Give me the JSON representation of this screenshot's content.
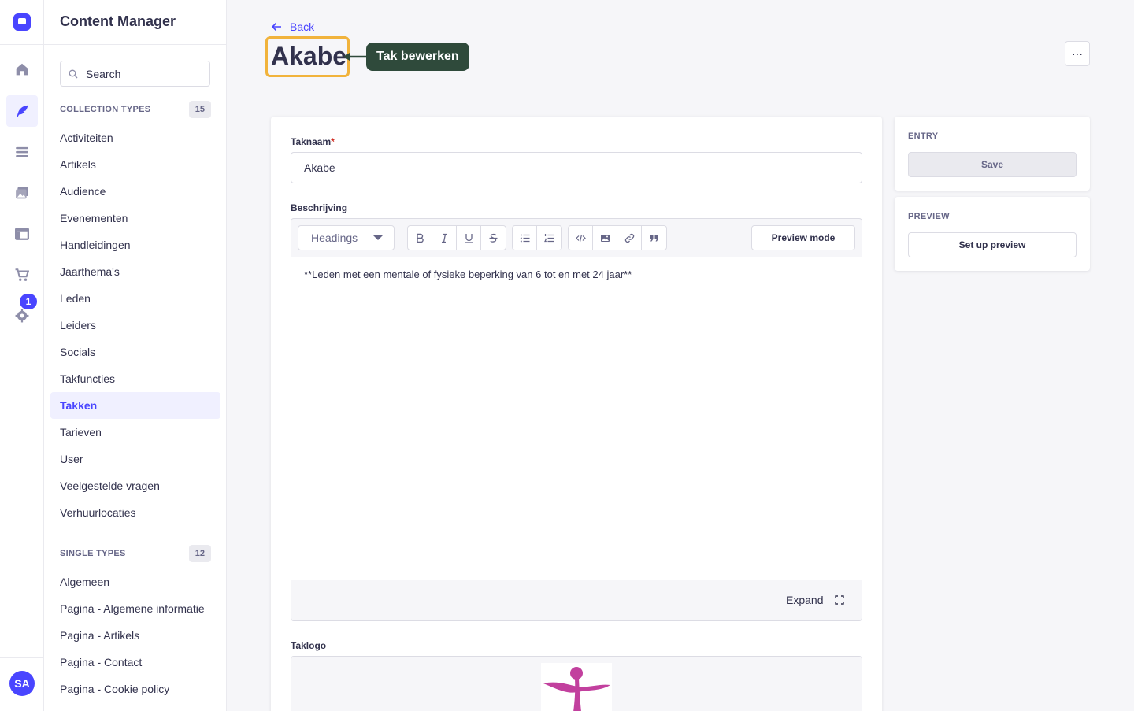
{
  "app": {
    "title": "Content Manager",
    "avatar_initials": "SA",
    "notification_count": "1"
  },
  "rail": {
    "items": [
      {
        "icon": "house-icon"
      },
      {
        "icon": "feather-icon",
        "active": true
      },
      {
        "icon": "list-icon"
      },
      {
        "icon": "images-icon"
      },
      {
        "icon": "layout-icon"
      },
      {
        "icon": "cart-icon"
      },
      {
        "icon": "gear-icon"
      }
    ]
  },
  "sidebar": {
    "search_placeholder": "Search",
    "collection": {
      "label": "COLLECTION TYPES",
      "count": "15",
      "items": [
        "Activiteiten",
        "Artikels",
        "Audience",
        "Evenementen",
        "Handleidingen",
        "Jaarthema's",
        "Leden",
        "Leiders",
        "Socials",
        "Takfuncties",
        "Takken",
        "Tarieven",
        "User",
        "Veelgestelde vragen",
        "Verhuurlocaties"
      ],
      "active": "Takken"
    },
    "single": {
      "label": "SINGLE TYPES",
      "count": "12",
      "items": [
        "Algemeen",
        "Pagina - Algemene informatie",
        "Pagina - Artikels",
        "Pagina - Contact",
        "Pagina - Cookie policy"
      ]
    }
  },
  "header": {
    "back_label": "Back",
    "title": "Akabe",
    "annotation": "Tak bewerken",
    "more_label": "···",
    "highlight_color": "#f1b33c",
    "annotation_color": "#2f4a3b"
  },
  "form": {
    "taknaam": {
      "label": "Taknaam",
      "required_mark": "*",
      "value": "Akabe"
    },
    "beschrijving": {
      "label": "Beschrijving",
      "headings_label": "Headings",
      "preview_mode_label": "Preview mode",
      "content": "**Leden met een mentale of fysieke beperking van 6 tot en met 24 jaar**",
      "expand_label": "Expand",
      "toolbar_groups": [
        [
          "bold-icon",
          "italic-icon",
          "underline-icon",
          "strikethrough-icon"
        ],
        [
          "bullet-list-icon",
          "numbered-list-icon"
        ],
        [
          "code-icon",
          "image-icon",
          "link-icon",
          "quote-icon"
        ]
      ]
    },
    "taklogo": {
      "label": "Taklogo"
    }
  },
  "side": {
    "entry": {
      "label": "ENTRY",
      "save_label": "Save"
    },
    "preview": {
      "label": "PREVIEW",
      "setup_label": "Set up preview"
    }
  },
  "colors": {
    "primary": "#4945ff",
    "logo_figure": "#c2409e"
  }
}
